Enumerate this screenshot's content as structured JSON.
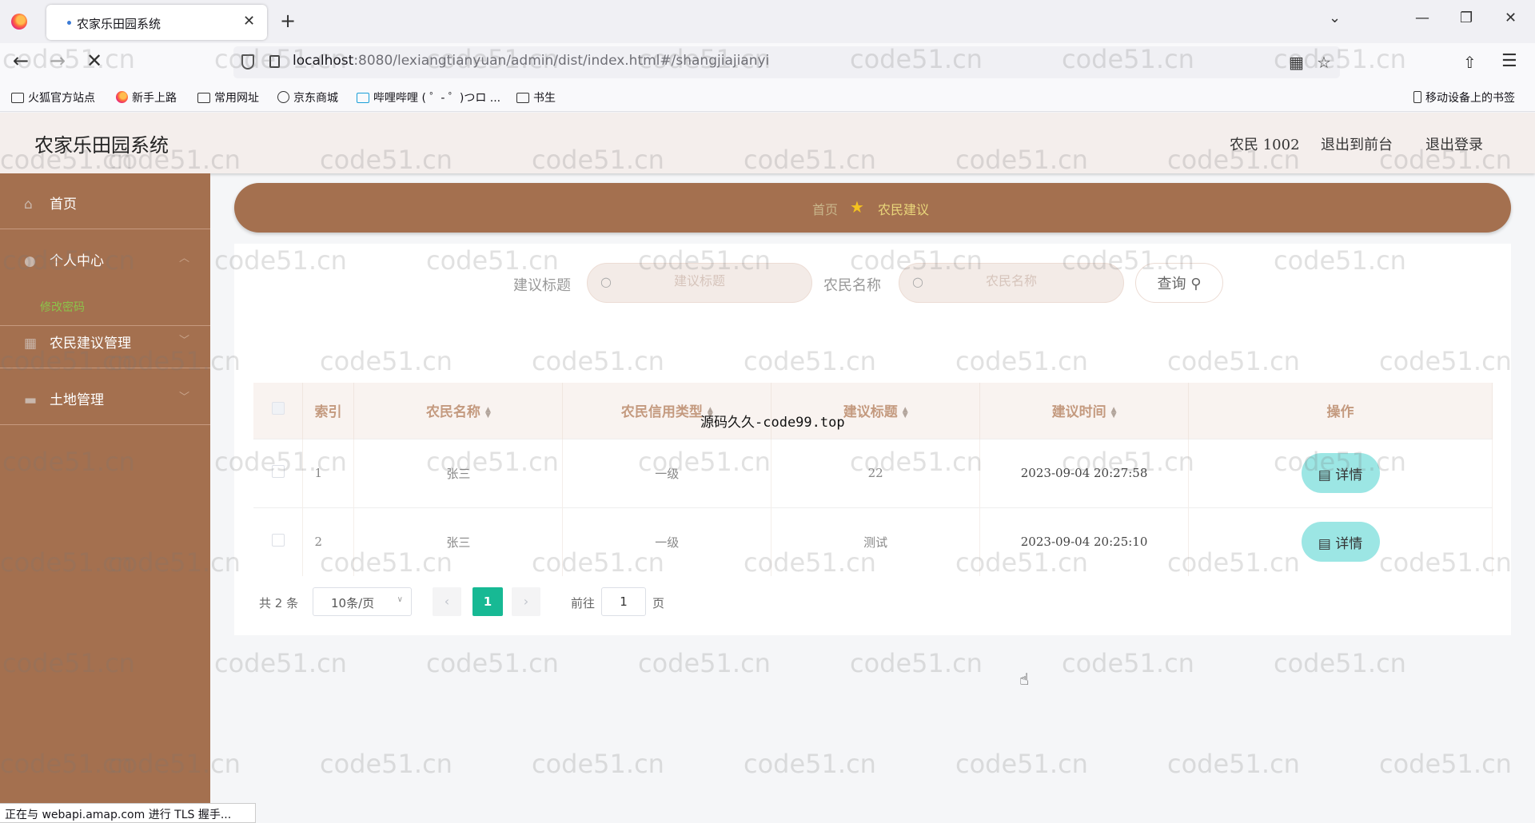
{
  "browser": {
    "tab_title": "农家乐田园系统",
    "url_host": "localhost",
    "url_rest": ":8080/lexiangtianyuan/admin/dist/index.html#/shangjiajianyi",
    "bookmarks": [
      "火狐官方站点",
      "新手上路",
      "常用网址",
      "京东商城",
      "哔哩哔哩 ( ゜- ゜)つロ ...",
      "书生"
    ],
    "mobile_bookmarks": "移动设备上的书签",
    "status_text": "正在与 webapi.amap.com 进行 TLS 握手..."
  },
  "header": {
    "title": "农家乐田园系统",
    "user": "农民 1002",
    "to_front": "退出到前台",
    "logout": "退出登录"
  },
  "sidebar": {
    "items": [
      {
        "label": "首页",
        "icon": "home-icon"
      },
      {
        "label": "个人中心",
        "icon": "user-icon"
      },
      {
        "label": "农民建议管理",
        "icon": "grid-icon"
      },
      {
        "label": "土地管理",
        "icon": "briefcase-icon"
      }
    ],
    "sub_item": "修改密码"
  },
  "breadcrumb": {
    "home": "首页",
    "current": "农民建议"
  },
  "search": {
    "title_label": "建议标题",
    "title_placeholder": "建议标题",
    "name_label": "农民名称",
    "name_placeholder": "农民名称",
    "query_button": "查询"
  },
  "table": {
    "headers": [
      "索引",
      "农民名称",
      "农民信用类型",
      "建议标题",
      "建议时间",
      "操作"
    ],
    "rows": [
      {
        "index": "1",
        "name": "张三",
        "credit": "一级",
        "title": "22",
        "time": "2023-09-04 20:27:58"
      },
      {
        "index": "2",
        "name": "张三",
        "credit": "一级",
        "title": "测试",
        "time": "2023-09-04 20:25:10"
      }
    ],
    "detail_label": "详情"
  },
  "overlay_text": "源码久久-code99.top",
  "pagination": {
    "total": "共 2 条",
    "page_size": "10条/页",
    "current_page": "1",
    "goto_label": "前往",
    "goto_value": "1",
    "page_label": "页"
  },
  "watermark": "code51.cn"
}
